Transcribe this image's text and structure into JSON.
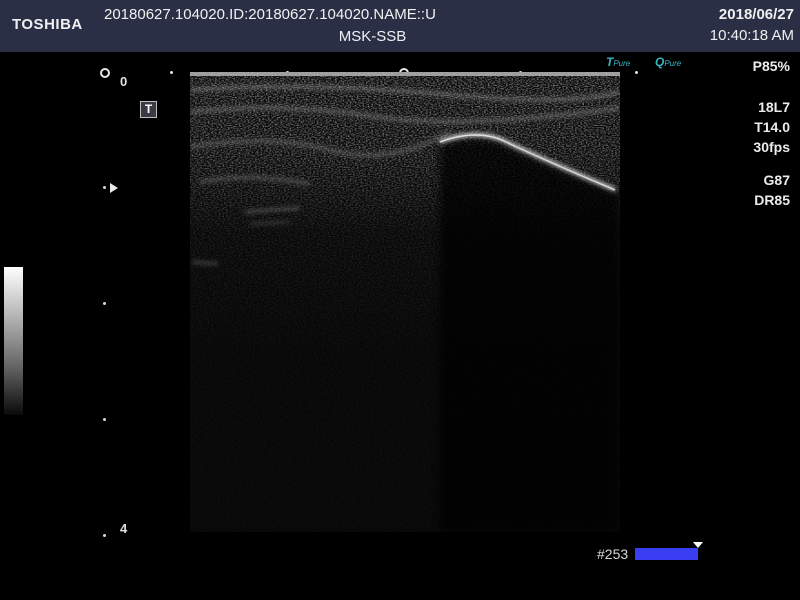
{
  "header": {
    "brand": "TOSHIBA",
    "patient_info": "20180627.104020.ID:20180627.104020.NAME::U",
    "preset": "MSK-SSB",
    "date": "2018/06/27",
    "time": "10:40:18 AM"
  },
  "depth_scale": {
    "top_label": "0",
    "bottom_label": "4"
  },
  "overlay": {
    "text_icon_label": "T"
  },
  "logos": {
    "logo1_mark": "T",
    "logo1_text": "Pure",
    "logo2_mark": "Q",
    "logo2_text": "Pure"
  },
  "parameters": {
    "power": "P85%",
    "probe": "18L7",
    "frequency": "T14.0",
    "frame_rate": "30fps",
    "gain": "G87",
    "dynamic_range": "DR85"
  },
  "frame_indicator": {
    "label": "#253",
    "color": "#3a3ef2"
  }
}
